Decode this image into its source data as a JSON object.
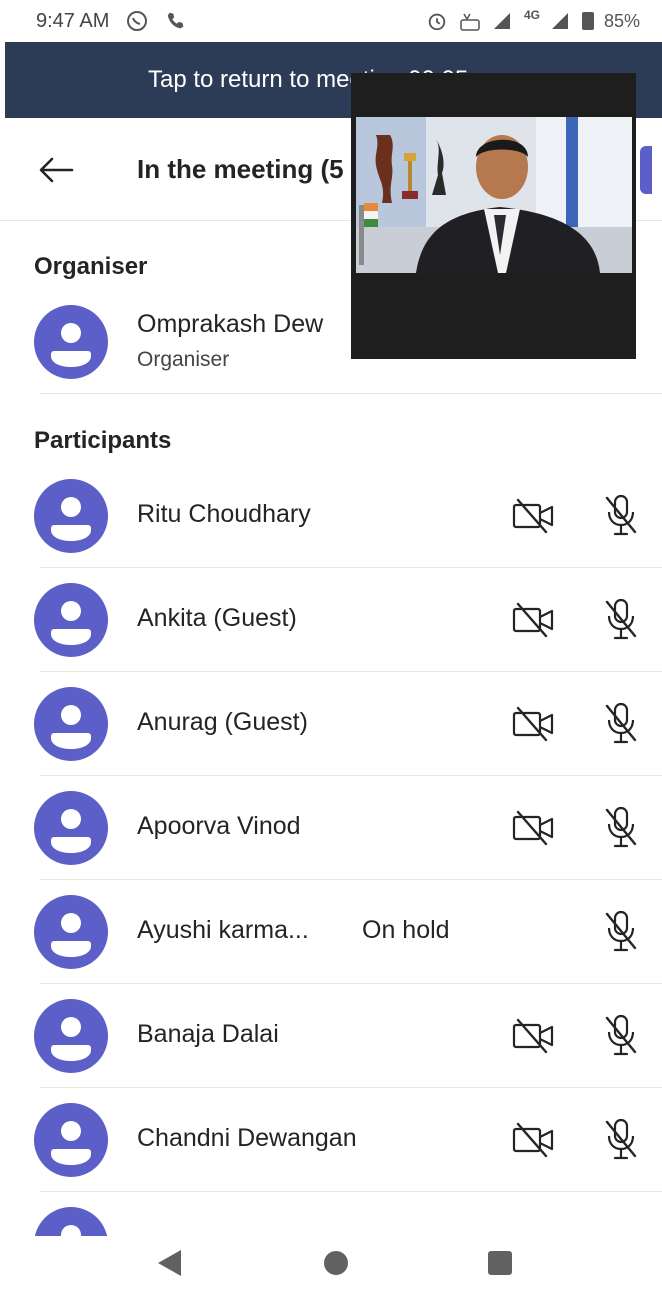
{
  "status_bar": {
    "time": "9:47 AM",
    "battery": "85%",
    "network": "4G",
    "icons": [
      "whatsapp-icon",
      "phone-icon",
      "alarm-icon",
      "volte-icon",
      "signal-icon",
      "battery-icon"
    ]
  },
  "banner": {
    "text": "Tap to return to meeting 00:05"
  },
  "header": {
    "title": "In the meeting (5",
    "back_icon": "arrow-left-icon"
  },
  "organiser_section": {
    "title": "Organiser",
    "person": {
      "name": "Omprakash Dew",
      "role": "Organiser"
    }
  },
  "participants_section": {
    "title": "Participants",
    "items": [
      {
        "name": "Ritu Choudhary"
      },
      {
        "name": "Ankita (Guest)"
      },
      {
        "name": "Anurag (Guest)"
      },
      {
        "name": "Apoorva Vinod"
      },
      {
        "name": "Ayushi karma...",
        "status": "On hold"
      },
      {
        "name": "Banaja Dalai"
      },
      {
        "name": "Chandni Dewangan"
      }
    ]
  },
  "colors": {
    "accent": "#5b5fc7",
    "banner_bg": "#2c3b56",
    "text": "#242424"
  }
}
